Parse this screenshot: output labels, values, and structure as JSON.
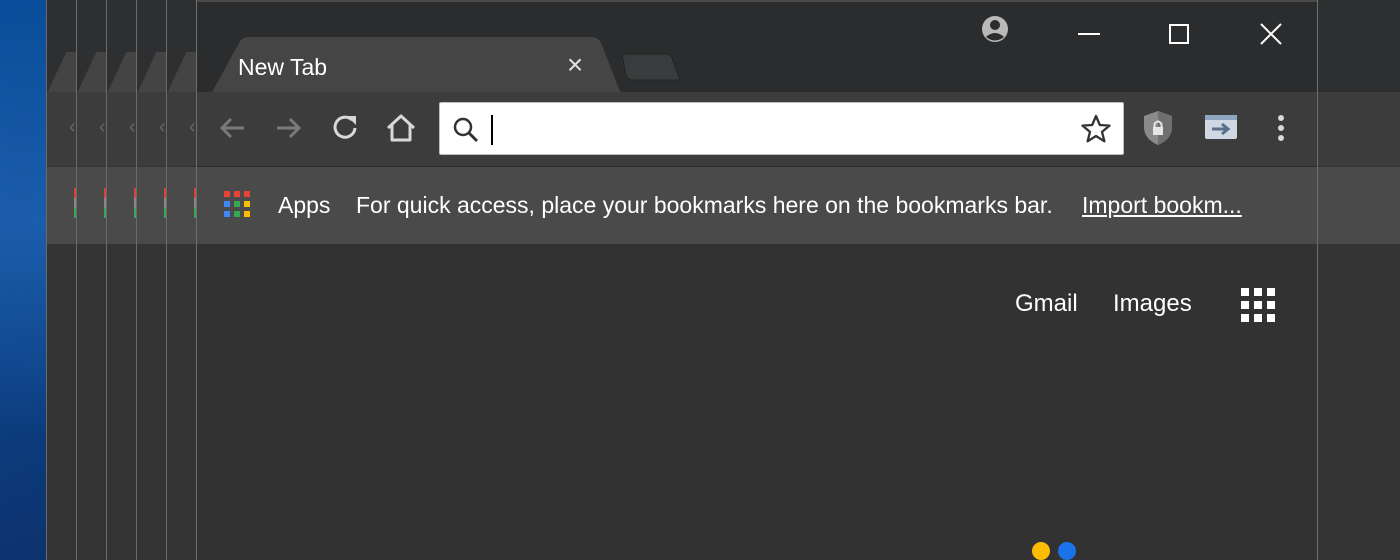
{
  "window": {
    "tab_title": "New Tab",
    "tab_close_symbol": "×",
    "controls": [
      "minimize-icon",
      "maximize-icon",
      "close-icon"
    ]
  },
  "toolbar": {
    "icons": [
      "back-arrow-icon",
      "forward-arrow-icon",
      "reload-icon",
      "home-icon"
    ],
    "omnibox": {
      "value": "",
      "placeholder": ""
    },
    "right_icons": [
      "bookmark-star-icon",
      "shield-extension-icon",
      "cast-extension-icon",
      "menu-dots-icon"
    ]
  },
  "bookmarks_bar": {
    "apps_label": "Apps",
    "hint": "For quick access, place your bookmarks here on the bookmarks bar.",
    "import_link": "Import bookm..."
  },
  "page": {
    "gmail": "Gmail",
    "images": "Images",
    "apps_icon": "google-apps-grid-icon"
  },
  "colors": {
    "titlebar": "#2b2c2e",
    "tab": "#454545",
    "toolbar": "#3c3c3c",
    "bookmarks_bar": "#4a4a4a",
    "page_bg": "#323232",
    "dot_yellow": "#fbbc04",
    "dot_blue": "#1a73e8"
  }
}
